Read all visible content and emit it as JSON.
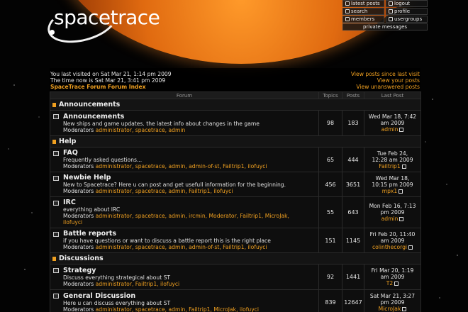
{
  "logo": {
    "text": "spacetrace"
  },
  "nav": {
    "latest_posts": "latest posts",
    "logout": "logout",
    "search": "search",
    "profile": "profile",
    "members": "members",
    "usergroups": "usergroups",
    "private_messages": "private messages"
  },
  "info": {
    "last_visit": "You last visited on Sat Mar 21, 1:14 pm 2009",
    "time_now": "The time now is Sat Mar 21, 3:41 pm 2009",
    "index_link": "SpaceTrace Forum Forum Index",
    "view_since": "View posts since last visit",
    "view_yours": "View your posts",
    "view_unanswered": "View unanswered posts"
  },
  "columns": {
    "forum": "Forum",
    "topics": "Topics",
    "posts": "Posts",
    "last_post": "Last Post"
  },
  "moderators_label": "Moderators",
  "categories": [
    {
      "name": "Announcements",
      "forums": [
        {
          "title": "Announcements",
          "desc": "New ships and game updates. the latest info about changes in the game",
          "mods": "administrator, spacetrace, admin",
          "topics": "98",
          "posts": "183",
          "last1": "Wed Mar 18, 7:42",
          "last2": "am 2009",
          "last_user": "admin"
        }
      ]
    },
    {
      "name": "Help",
      "forums": [
        {
          "title": "FAQ",
          "desc": "Frequently asked questions...",
          "mods": "administrator, spacetrace, admin, admin-of-st, Failtrip1, ilofuyci",
          "topics": "65",
          "posts": "444",
          "last1": "Tue Feb 24,",
          "last2": "12:28 am 2009",
          "last_user": "Failtrip1"
        },
        {
          "title": "Newbie Help",
          "desc": "New to Spacetrace? Here u can post and get usefull information for the beginning.",
          "mods": "administrator, spacetrace, admin, Failtrip1, ilofuyci",
          "topics": "456",
          "posts": "3651",
          "last1": "Wed Mar 18,",
          "last2": "10:15 pm 2009",
          "last_user": "mpx1"
        },
        {
          "title": "IRC",
          "desc": "everything about IRC",
          "mods": "administrator, spacetrace, admin, ircmin, Moderator, Failtrip1, MicroJak,",
          "mods2": "ilofuyci",
          "topics": "55",
          "posts": "643",
          "last1": "Mon Feb 16, 7:13",
          "last2": "pm 2009",
          "last_user": "admin"
        },
        {
          "title": "Battle reports",
          "desc": "if you have questions or want to discuss a battle report this is the right place",
          "mods": "administrator, spacetrace, admin, admin-of-st, Failtrip1, ilofuyci",
          "topics": "151",
          "posts": "1145",
          "last1": "Fri Feb 20, 11:40",
          "last2": "am 2009",
          "last_user": "colinthecorgi"
        }
      ]
    },
    {
      "name": "Discussions",
      "forums": [
        {
          "title": "Strategy",
          "desc": "Discuss everything strategical about ST",
          "mods": "administrator, Failtrip1, ilofuyci",
          "topics": "92",
          "posts": "1441",
          "last1": "Fri Mar 20, 1:19",
          "last2": "am 2009",
          "last_user": "T2"
        },
        {
          "title": "General Discussion",
          "desc": "Here u can discuss everything about ST",
          "mods": "administrator, spacetrace, admin, Failtrip1, MicroJak, ilofuyci",
          "topics": "839",
          "posts": "12647",
          "last1": "Sat Mar 21, 3:27",
          "last2": "pm 2009",
          "last_user": "MicroJak"
        }
      ]
    }
  ]
}
